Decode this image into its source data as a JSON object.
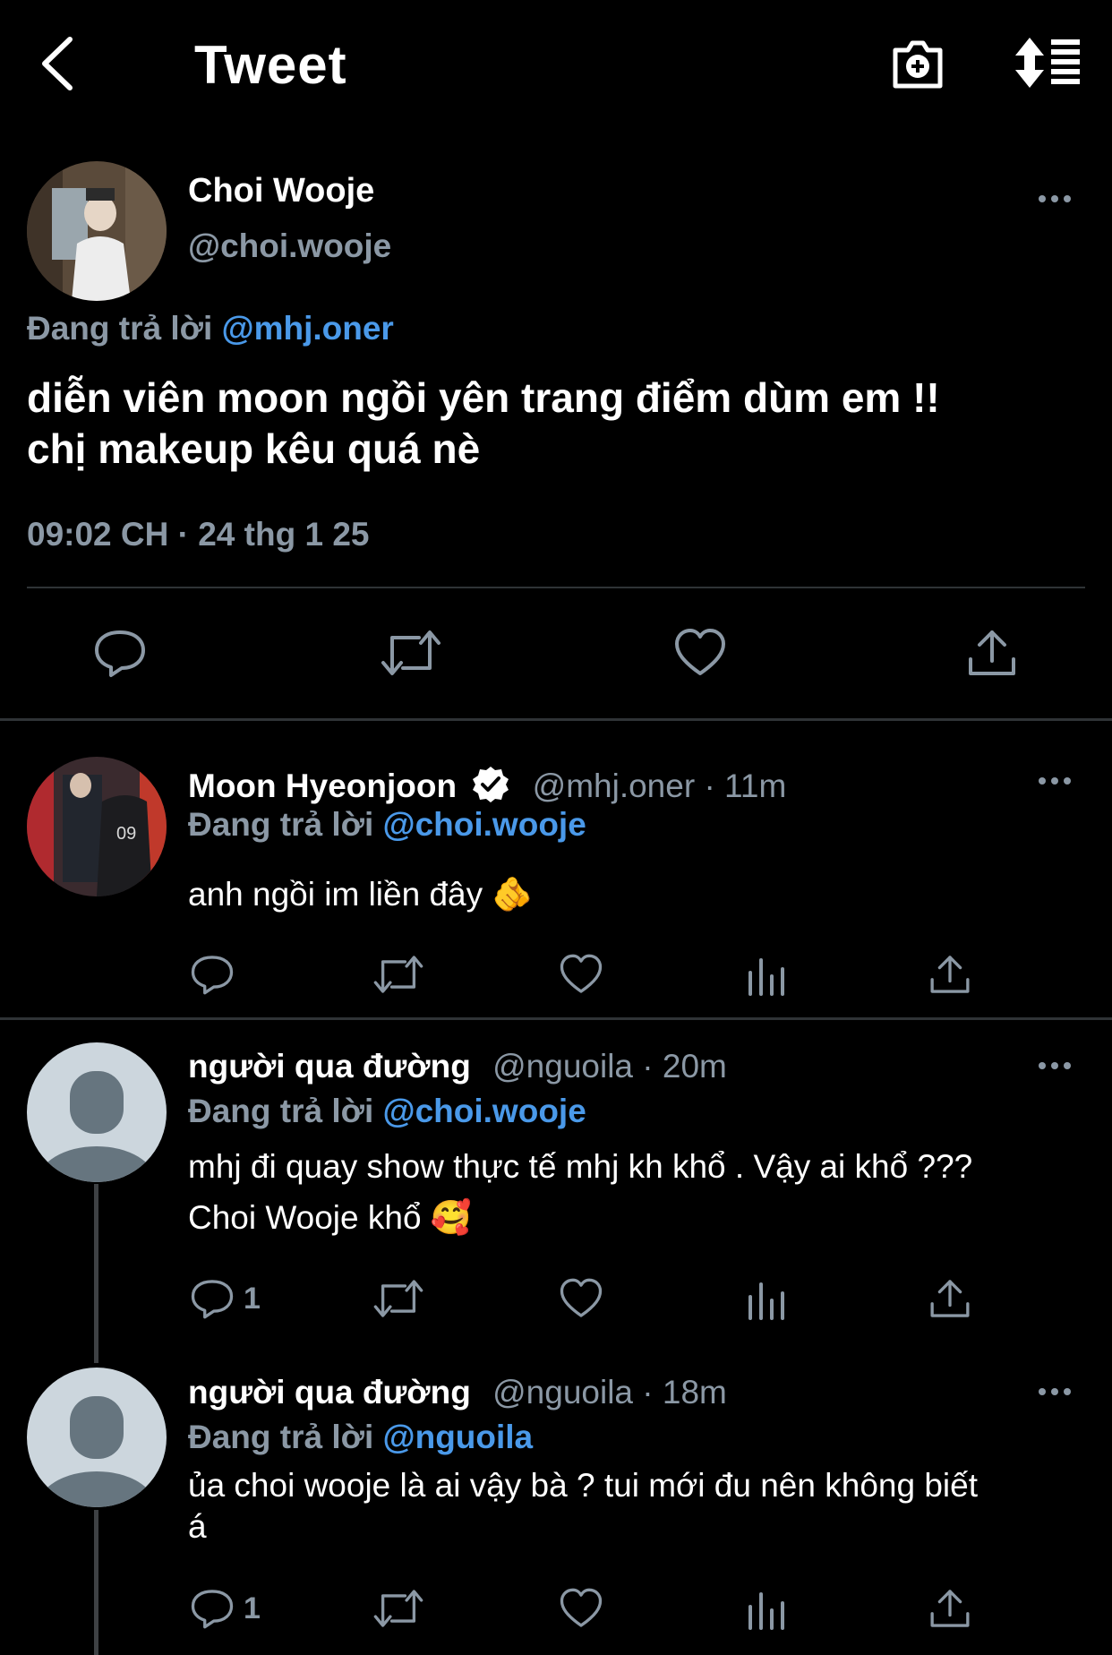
{
  "header": {
    "title": "Tweet",
    "back_icon": "chevron-left-icon",
    "camera_icon": "camera-plus-icon",
    "sort_icon": "sort-list-icon"
  },
  "main_tweet": {
    "name": "Choi Wooje",
    "handle": "@choi.wooje",
    "reply_prefix": "Đang trả lời",
    "reply_to": "@mhj.oner",
    "text_line1": "diễn viên moon ngồi yên trang điểm dùm em !!",
    "text_line2": "chị makeup kêu quá nè",
    "timestamp": "09:02 CH · 24 thg 1 25"
  },
  "replies": [
    {
      "name": "Moon Hyeonjoon",
      "verified": true,
      "handle": "@mhj.oner",
      "time": "11m",
      "reply_prefix": "Đang trả lời",
      "reply_to": "@choi.wooje",
      "text": "anh ngồi im liền đây 🫵",
      "reply_count": ""
    },
    {
      "name": "người qua đường",
      "handle": "@nguoila",
      "time": "20m",
      "reply_prefix": "Đang trả lời",
      "reply_to": "@choi.wooje",
      "text_line1": "mhj đi quay show thực tế mhj kh khổ . Vậy ai khổ ???",
      "text_line2": "Choi Wooje khổ 🥰",
      "reply_count": "1"
    },
    {
      "name": "người qua đường",
      "handle": "@nguoila",
      "time": "18m",
      "reply_prefix": "Đang trả lời",
      "reply_to": "@nguoila",
      "text_line1": "ủa choi wooje là ai vậy bà ? tui mới đu nên không biết",
      "text_line2": "á",
      "reply_count": "1"
    }
  ],
  "colors": {
    "background": "#000000",
    "text": "#ffffff",
    "secondary": "#8b98a5",
    "link": "#4a99e9",
    "divider": "#2f3336"
  }
}
